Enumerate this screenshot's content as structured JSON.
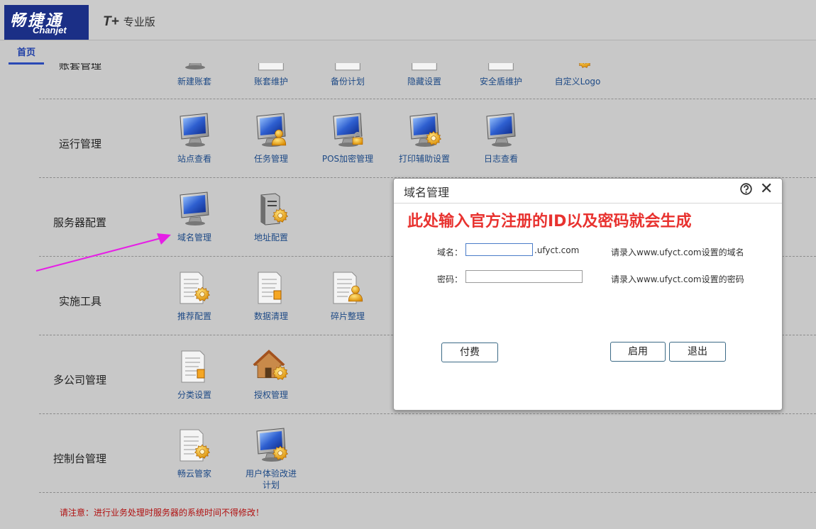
{
  "brand": {
    "cn": "畅捷通",
    "en": "Chanjet",
    "product": "T+",
    "edition": "专业版"
  },
  "tabs": {
    "home": "首页"
  },
  "sections": {
    "account": {
      "label": "账套管理",
      "items": [
        "新建账套",
        "账套维护",
        "备份计划",
        "隐藏设置",
        "安全盾维护",
        "自定义Logo"
      ]
    },
    "run": {
      "label": "运行管理",
      "items": [
        "站点查看",
        "任务管理",
        "POS加密管理",
        "打印辅助设置",
        "日志查看"
      ]
    },
    "server": {
      "label": "服务器配置",
      "items": [
        "域名管理",
        "地址配置"
      ]
    },
    "impl": {
      "label": "实施工具",
      "items": [
        "推荐配置",
        "数据清理",
        "碎片整理"
      ]
    },
    "multi": {
      "label": "多公司管理",
      "items": [
        "分类设置",
        "授权管理"
      ]
    },
    "console": {
      "label": "控制台管理",
      "items": [
        "畅云管家",
        "用户体验改进计划"
      ]
    }
  },
  "warning": "请注意：进行业务处理时服务器的系统时间不得修改！",
  "dialog": {
    "title": "域名管理",
    "note": "此处输入官方注册的ID以及密码就会生成",
    "domain_label": "域名：",
    "domain_value": "",
    "domain_suffix": ".ufyct.com",
    "domain_hint": "请录入www.ufyct.com设置的域名",
    "password_label": "密码：",
    "password_value": "",
    "password_hint": "请录入www.ufyct.com设置的密码",
    "pay_button": "付费",
    "enable_button": "启用",
    "exit_button": "退出"
  },
  "colors": {
    "brand": "#1b2f86",
    "accent_red": "#e8322f",
    "link_blue": "#1e4a86",
    "arrow": "#e61ee6"
  }
}
